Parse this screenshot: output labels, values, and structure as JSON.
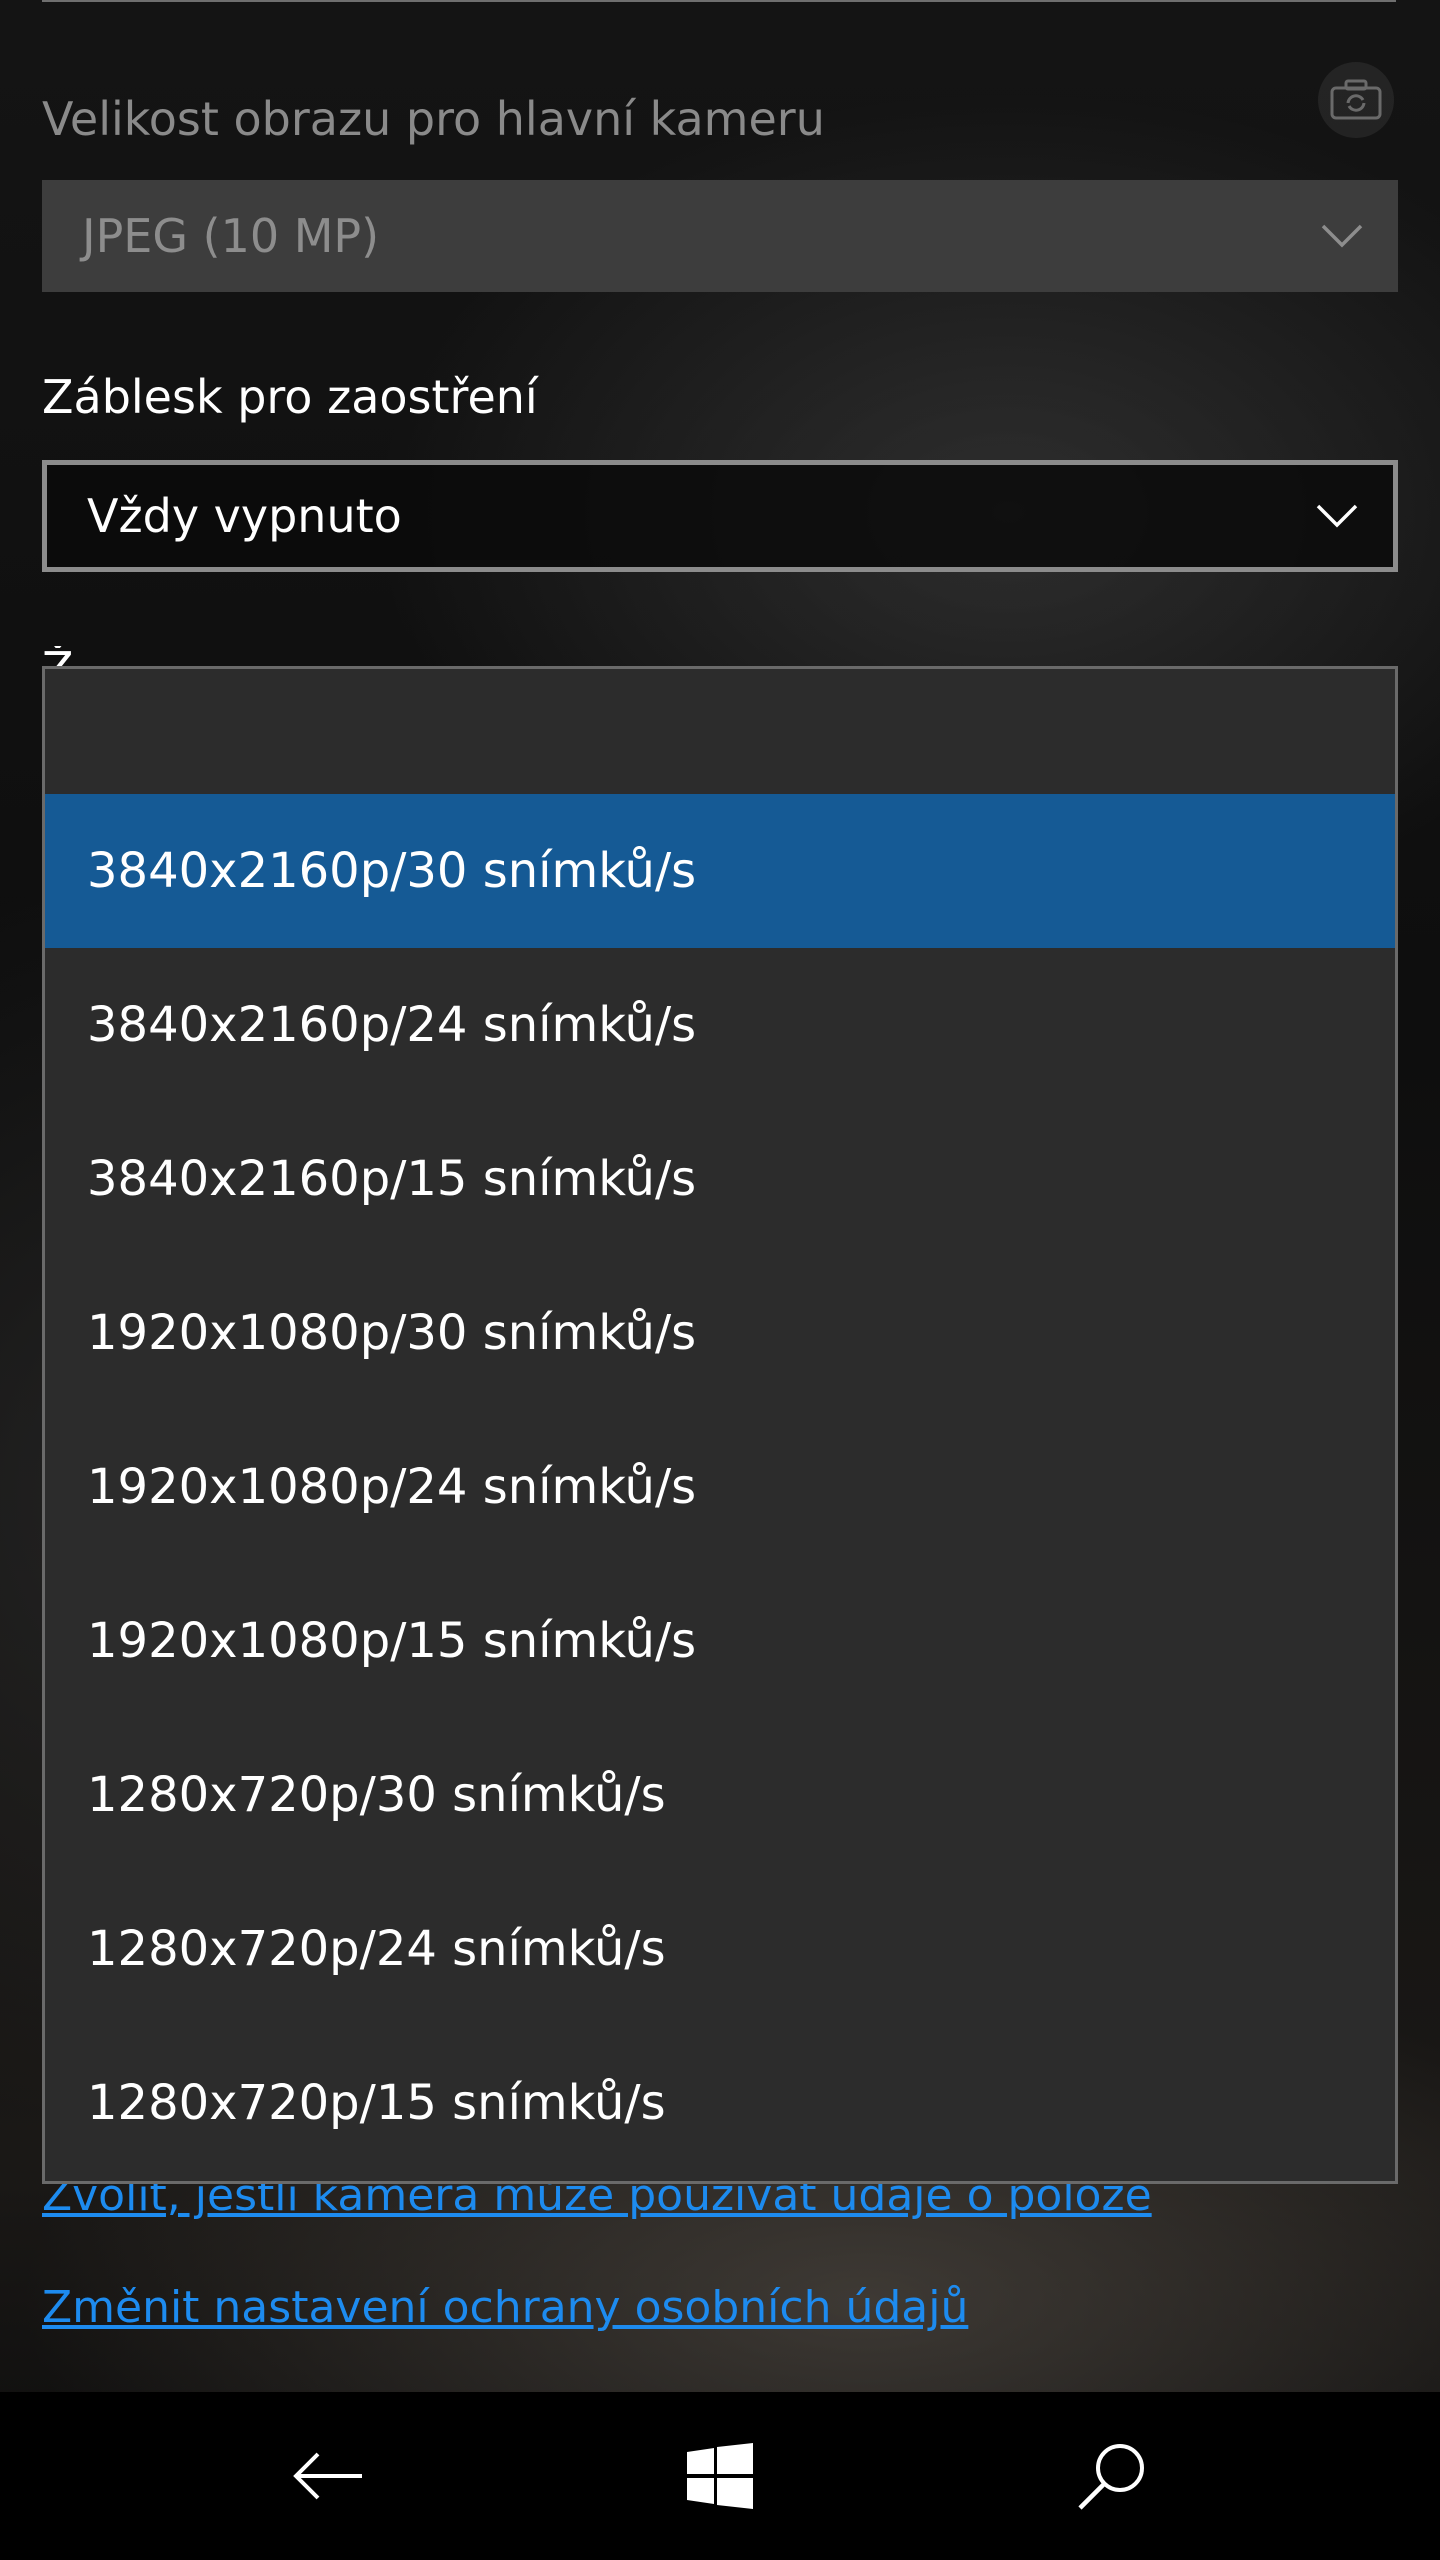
{
  "settings": {
    "main_camera_label": "Velikost obrazu pro hlavní kameru",
    "main_camera_value": "JPEG (10 MP)",
    "focus_flash_label": "Záblesk pro zaostření",
    "focus_flash_value": "Vždy vypnuto",
    "hidden_label_fragment": "Ž"
  },
  "dropdown": {
    "selected_index": 0,
    "options": [
      "3840x2160p/30 snímků/s",
      "3840x2160p/24 snímků/s",
      "3840x2160p/15 snímků/s",
      "1920x1080p/30 snímků/s",
      "1920x1080p/24 snímků/s",
      "1920x1080p/15 snímků/s",
      "1280x720p/30 snímků/s",
      "1280x720p/24 snímků/s",
      "1280x720p/15 snímků/s"
    ]
  },
  "links": {
    "location": "Zvolit, jestli kamera může používat údaje o poloze",
    "privacy": "Změnit nastavení ochrany osobních údajů"
  },
  "colors": {
    "accent": "#155a95",
    "link": "#1d8bef"
  },
  "icons": {
    "camera": "camera-switch-icon",
    "back": "back-arrow-icon",
    "start": "windows-logo-icon",
    "search": "search-icon"
  }
}
